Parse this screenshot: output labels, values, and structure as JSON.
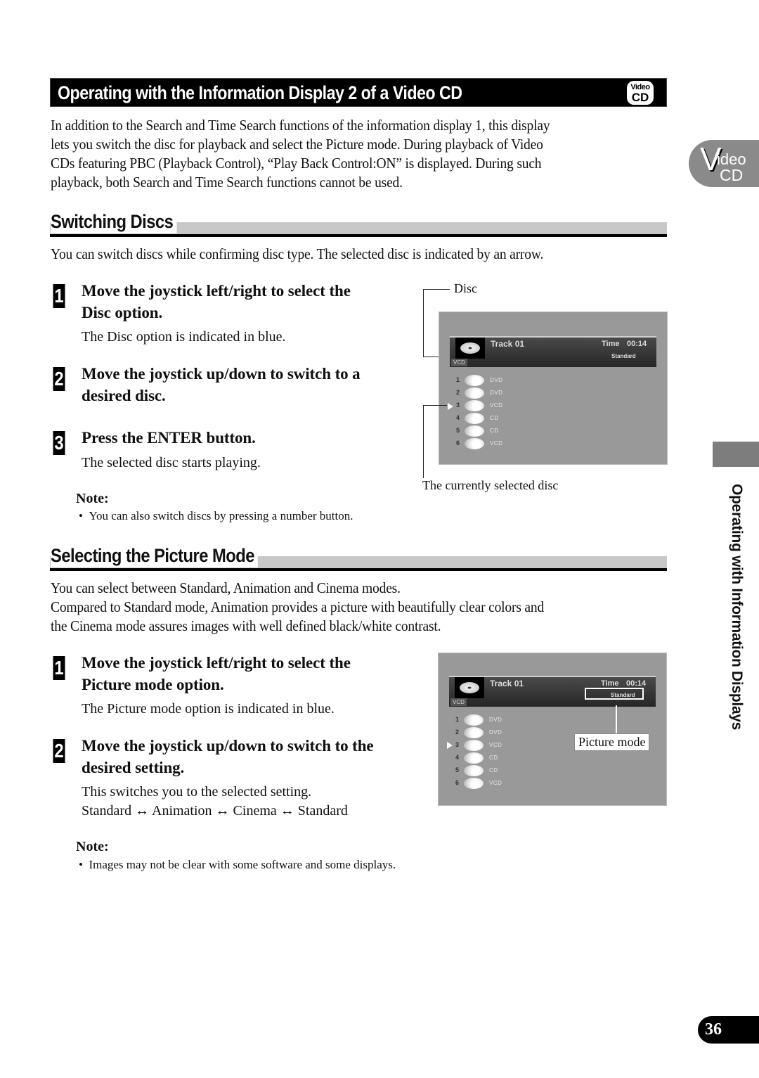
{
  "header": {
    "title": "Operating with the Information Display 2 of a Video CD",
    "logo": {
      "line1": "Video",
      "line2": "CD"
    }
  },
  "intro": {
    "lines": [
      "In addition to the Search and Time Search functions of the information display 1, this display",
      "lets you switch the disc for playback and select the Picture mode. During playback of Video",
      "CDs featuring PBC (Playback Control), “Play Back Control:ON” is displayed. During such",
      "playback, both Search and Time Search functions cannot be used."
    ]
  },
  "side_tab": {
    "v": "V",
    "ideo": "ideo",
    "cd": "CD"
  },
  "switching": {
    "heading": "Switching Discs",
    "description": "You can switch discs while confirming disc type. The selected disc is indicated by an arrow.",
    "steps": [
      {
        "num": "1",
        "title_lines": [
          "Move the joystick left/right to select the",
          "Disc option."
        ],
        "desc": "The Disc option is indicated in blue."
      },
      {
        "num": "2",
        "title_lines": [
          "Move the joystick up/down to switch to a",
          "desired disc."
        ],
        "desc": ""
      },
      {
        "num": "3",
        "title_lines": [
          "Press the ENTER button."
        ],
        "desc": "The selected disc starts playing."
      }
    ],
    "note_label": "Note:",
    "note_items": [
      "You can also switch discs by pressing a number button."
    ],
    "figure": {
      "callout_top": "Disc",
      "callout_bottom": "The currently selected disc"
    }
  },
  "screen": {
    "track": "Track 01",
    "time_label": "Time",
    "time_value": "00:14",
    "mode": "Standard",
    "disc_tag": "VCD",
    "discs": [
      {
        "num": "1",
        "type": "DVD"
      },
      {
        "num": "2",
        "type": "DVD"
      },
      {
        "num": "3",
        "type": "VCD",
        "selected": true
      },
      {
        "num": "4",
        "type": "CD"
      },
      {
        "num": "5",
        "type": "CD"
      },
      {
        "num": "6",
        "type": "VCD"
      }
    ]
  },
  "picture_mode": {
    "heading": "Selecting the Picture Mode",
    "description_lines": [
      "You can select between Standard, Animation and Cinema modes.",
      "Compared to Standard mode, Animation provides a picture with beautifully clear colors and",
      "the Cinema mode assures images with well defined black/white contrast."
    ],
    "steps": [
      {
        "num": "1",
        "title_lines": [
          "Move the joystick left/right to select the",
          "Picture mode option."
        ],
        "desc": "The Picture mode option is indicated in blue."
      },
      {
        "num": "2",
        "title_lines": [
          "Move the joystick up/down to switch to the",
          "desired setting."
        ],
        "desc": "This switches you to the selected setting."
      }
    ],
    "cycle": [
      "Standard",
      "Animation",
      "Cinema",
      "Standard"
    ],
    "cycle_arrow": "↔",
    "note_label": "Note:",
    "note_items": [
      "Images may not be clear with some software and some displays."
    ],
    "figure": {
      "callout": "Picture mode"
    }
  },
  "side_label": "Operating with Information Displays",
  "page_number": "36"
}
